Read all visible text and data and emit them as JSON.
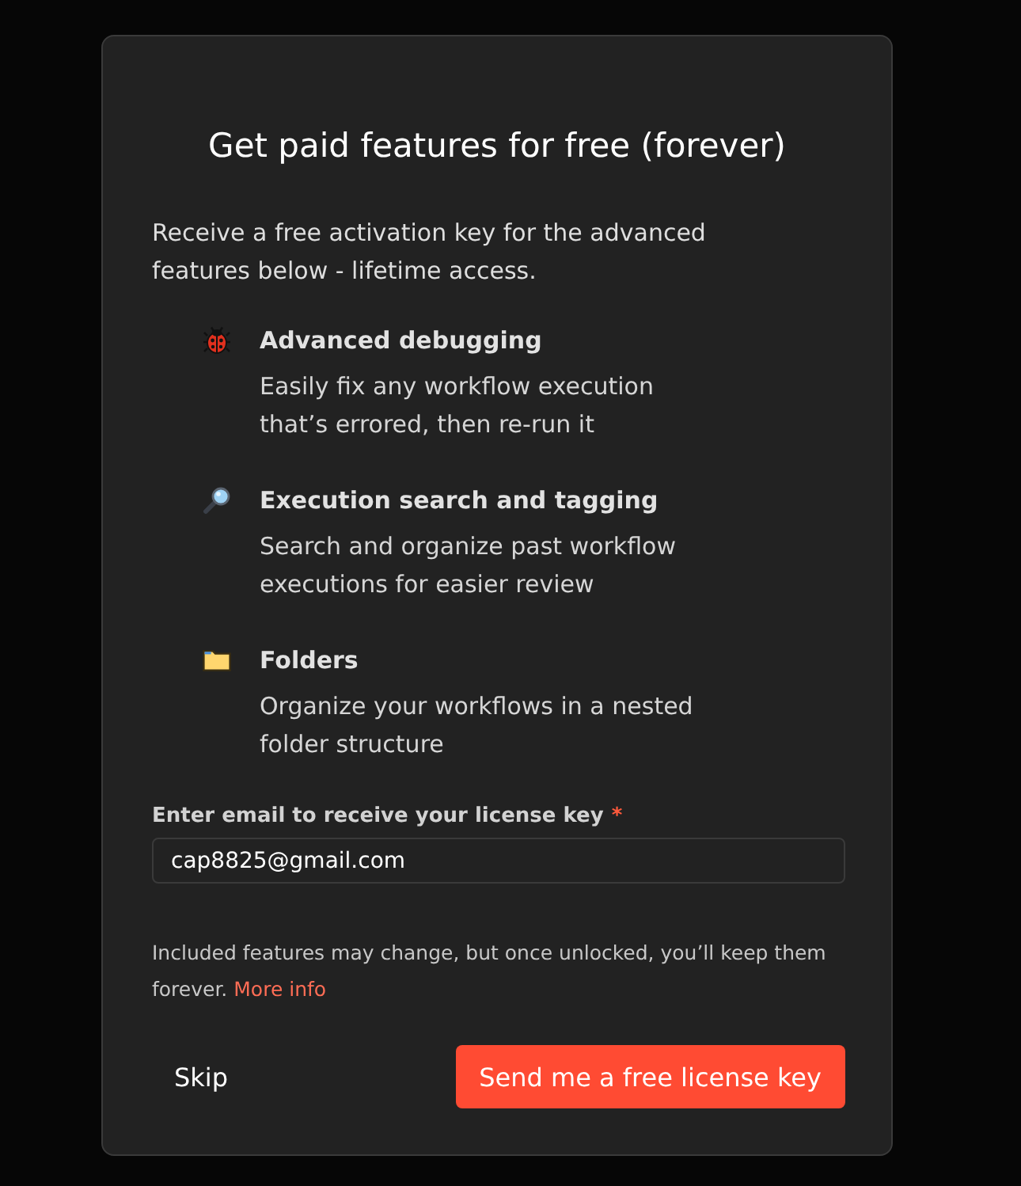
{
  "dialog": {
    "title": "Get paid features for free (forever)",
    "intro": "Receive a free activation key for the advanced features below - lifetime access.",
    "features": [
      {
        "kind": "bug",
        "title": "Advanced debugging",
        "description": "Easily fix any workflow execution that’s errored, then re-run it"
      },
      {
        "kind": "magnifier",
        "title": "Execution search and tagging",
        "description": "Search and organize past workflow executions for easier review"
      },
      {
        "kind": "folder",
        "title": "Folders",
        "description": "Organize your workflows in a nested folder structure"
      }
    ],
    "email_field": {
      "label": "Enter email to receive your license key",
      "required_mark": "*",
      "value": "cap8825@gmail.com"
    },
    "note": {
      "text": "Included features may change, but once unlocked, you’ll keep them forever.",
      "link": "More info"
    },
    "buttons": [
      {
        "kind": "secondary",
        "label": "Skip"
      },
      {
        "kind": "primary",
        "label": "Send me a free license key"
      }
    ]
  }
}
